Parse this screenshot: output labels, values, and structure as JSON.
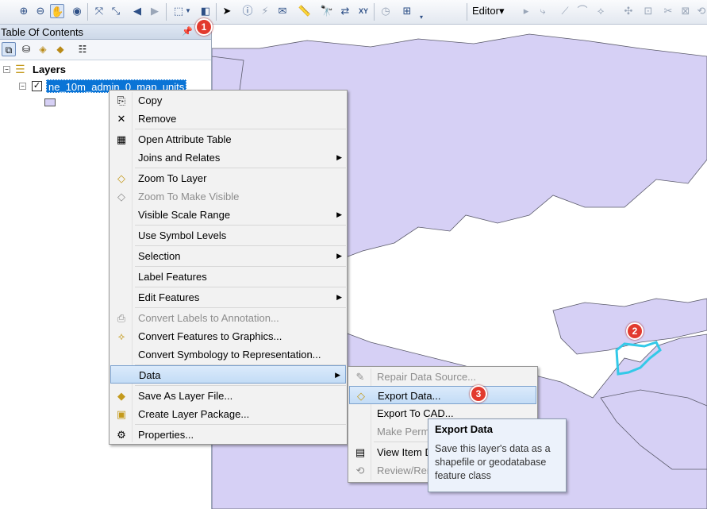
{
  "toolbar": {
    "editor_label": "Editor▾"
  },
  "toc": {
    "title": "Table Of Contents",
    "root_label": "Layers",
    "layer_label": "ne_10m_admin_0_map_units"
  },
  "context_menu": {
    "items": [
      {
        "label": "Copy",
        "icon": "copy-icon"
      },
      {
        "label": "Remove",
        "icon": "remove-icon"
      },
      {
        "label": "Open Attribute Table",
        "icon": "table-icon"
      },
      {
        "label": "Joins and Relates"
      },
      {
        "label": "Zoom To Layer",
        "icon": "zoom-layer-icon"
      },
      {
        "label": "Zoom To Make Visible",
        "icon": "zoom-visible-icon"
      },
      {
        "label": "Visible Scale Range"
      },
      {
        "label": "Use Symbol Levels"
      },
      {
        "label": "Selection"
      },
      {
        "label": "Label Features"
      },
      {
        "label": "Edit Features"
      },
      {
        "label": "Convert Labels to Annotation...",
        "icon": "annotation-icon"
      },
      {
        "label": "Convert Features to Graphics...",
        "icon": "graphics-icon"
      },
      {
        "label": "Convert Symbology to Representation..."
      },
      {
        "label": "Data"
      },
      {
        "label": "Save As Layer File...",
        "icon": "layer-file-icon"
      },
      {
        "label": "Create Layer Package...",
        "icon": "package-icon"
      },
      {
        "label": "Properties...",
        "icon": "properties-icon"
      }
    ]
  },
  "data_submenu": {
    "items": [
      {
        "label": "Repair Data Source..."
      },
      {
        "label": "Export Data..."
      },
      {
        "label": "Export To CAD..."
      },
      {
        "label": "Make Perm"
      },
      {
        "label": "View Item D"
      },
      {
        "label": "Review/Ren"
      }
    ]
  },
  "tooltip": {
    "title": "Export Data",
    "description": "Save this layer's data as a shapefile or geodatabase feature class"
  },
  "badges": [
    "1",
    "2",
    "3"
  ],
  "colors": {
    "land": "#d6d0f5",
    "border": "#5a5a6a",
    "highlight": "#33c9e8",
    "badge": "#e23a2e"
  }
}
